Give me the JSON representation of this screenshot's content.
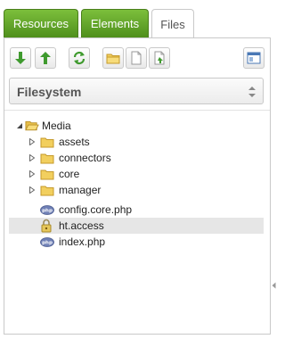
{
  "tabs": [
    {
      "label": "Resources"
    },
    {
      "label": "Elements"
    },
    {
      "label": "Files"
    }
  ],
  "toolbar": {
    "buttons": [
      {
        "icon": "arrow-down-icon"
      },
      {
        "icon": "arrow-up-icon"
      },
      {
        "icon": "refresh-icon"
      },
      {
        "icon": "new-folder-icon"
      },
      {
        "icon": "new-file-icon"
      },
      {
        "icon": "upload-file-icon"
      },
      {
        "icon": "window-icon"
      }
    ]
  },
  "source_select": {
    "value": "Filesystem"
  },
  "tree": {
    "root": {
      "label": "Media"
    },
    "folders": [
      {
        "label": "assets"
      },
      {
        "label": "connectors"
      },
      {
        "label": "core"
      },
      {
        "label": "manager"
      }
    ],
    "files": [
      {
        "label": "config.core.php",
        "icon": "php-file-icon"
      },
      {
        "label": "ht.access",
        "icon": "lock-icon",
        "selected": true
      },
      {
        "label": "index.php",
        "icon": "php-file-icon"
      }
    ]
  },
  "colors": {
    "tab_green": "#5fa32a",
    "folder_yellow": "#f2cf5e",
    "arrow_green": "#3f9a2e"
  }
}
